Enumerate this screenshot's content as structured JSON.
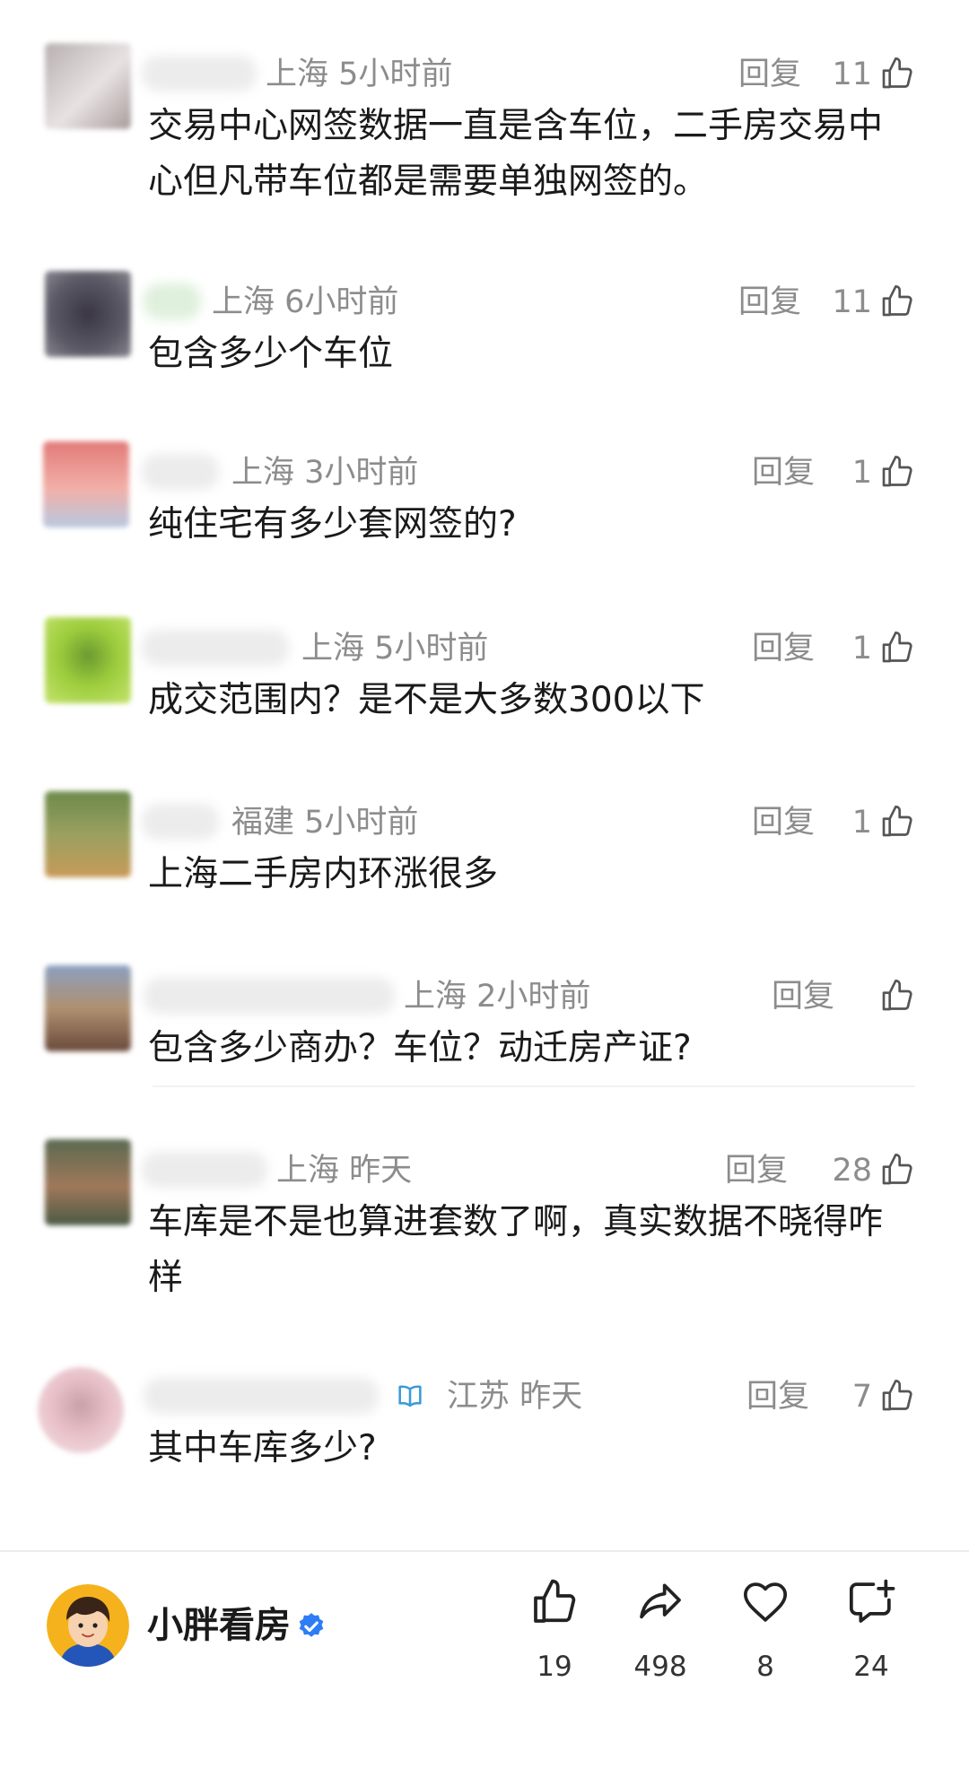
{
  "comments": [
    {
      "location": "上海",
      "time": "5小时前",
      "reply_label": "回复",
      "likes": "11",
      "text": "交易中心网签数据一直是含车位，二手房交易中心但凡带车位都是需要单独网签的。",
      "avatar_color": "#c9c4c4"
    },
    {
      "location": "上海",
      "time": "6小时前",
      "reply_label": "回复",
      "likes": "11",
      "text": "包含多少个车位",
      "avatar_color": "#4a4850"
    },
    {
      "location": "上海",
      "time": "3小时前",
      "reply_label": "回复",
      "likes": "1",
      "text": "纯住宅有多少套网签的?",
      "avatar_color": "#d96a6a"
    },
    {
      "location": "上海",
      "time": "5小时前",
      "reply_label": "回复",
      "likes": "1",
      "text": "成交范围内？是不是大多数300以下",
      "avatar_color": "#9ccc3c"
    },
    {
      "location": "福建",
      "time": "5小时前",
      "reply_label": "回复",
      "likes": "1",
      "text": "上海二手房内环涨很多",
      "avatar_color": "#7c8c5a"
    },
    {
      "location": "上海",
      "time": "2小时前",
      "reply_label": "回复",
      "likes": "",
      "text": "包含多少商办？车位？动迁房产证?",
      "avatar_color": "#8a7a6a"
    },
    {
      "location": "上海",
      "time": "昨天",
      "reply_label": "回复",
      "likes": "28",
      "text": "车库是不是也算进套数了啊，真实数据不晓得咋样",
      "avatar_color": "#6a7460"
    },
    {
      "location": "江苏",
      "time": "昨天",
      "reply_label": "回复",
      "likes": "7",
      "text": "其中车库多少?",
      "avatar_color": "#d9a0a8"
    }
  ],
  "author": {
    "name": "小胖看房",
    "verified_color": "#2d7df6"
  },
  "actions": {
    "like_count": "19",
    "share_count": "498",
    "favorite_count": "8",
    "comment_count": "24"
  },
  "icons": {
    "like": "thumbs-up-icon",
    "share": "share-arrow-icon",
    "favorite": "heart-icon",
    "comment": "comment-plus-icon",
    "verified": "verified-check-icon",
    "badge": "book-badge-icon"
  }
}
